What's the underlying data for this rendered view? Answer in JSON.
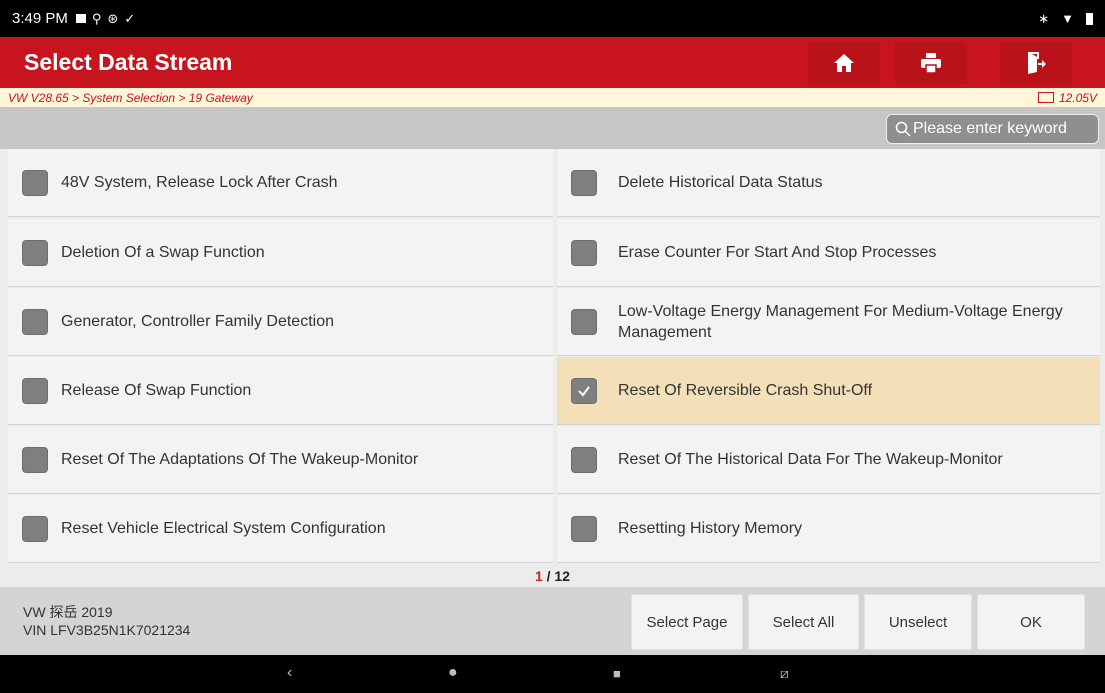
{
  "status_bar": {
    "time": "3:49 PM",
    "icons": [
      "notification-icon",
      "usb-icon",
      "settings-icon",
      "check-icon"
    ],
    "right_icons": [
      "bluetooth-icon",
      "wifi-icon",
      "battery-icon"
    ]
  },
  "header": {
    "title": "Select Data Stream",
    "buttons": [
      "home-icon",
      "print-icon",
      "exit-icon"
    ]
  },
  "breadcrumb": {
    "path": "VW V28.65 > System Selection > 19 Gateway",
    "voltage": "12.05V"
  },
  "search": {
    "placeholder": "Please enter keyword"
  },
  "items": [
    {
      "label": "48V System, Release Lock After Crash",
      "checked": false
    },
    {
      "label": "Delete Historical Data Status",
      "checked": false
    },
    {
      "label": "Deletion Of a Swap Function",
      "checked": false
    },
    {
      "label": "Erase Counter For Start And Stop Processes",
      "checked": false
    },
    {
      "label": "Generator, Controller Family Detection",
      "checked": false
    },
    {
      "label": "Low-Voltage Energy Management For Medium-Voltage Energy Management",
      "checked": false
    },
    {
      "label": "Release Of Swap Function",
      "checked": false
    },
    {
      "label": "Reset Of Reversible Crash Shut-Off",
      "checked": true
    },
    {
      "label": "Reset Of The Adaptations Of The Wakeup-Monitor",
      "checked": false
    },
    {
      "label": "Reset Of The Historical Data For The Wakeup-Monitor",
      "checked": false
    },
    {
      "label": "Reset Vehicle Electrical System Configuration",
      "checked": false
    },
    {
      "label": "Resetting History Memory",
      "checked": false
    }
  ],
  "pager": {
    "current": "1",
    "total": " / 12"
  },
  "vehicle": {
    "model": "VW 探岳 2019",
    "vin": "VIN LFV3B25N1K7021234"
  },
  "actions": {
    "select_page": "Select Page",
    "select_all": "Select All",
    "unselect": "Unselect",
    "ok": "OK"
  },
  "colors": {
    "header": "#c8141e",
    "selected_row": "#f4e0b8",
    "crumb_bg": "#fff6dc"
  }
}
